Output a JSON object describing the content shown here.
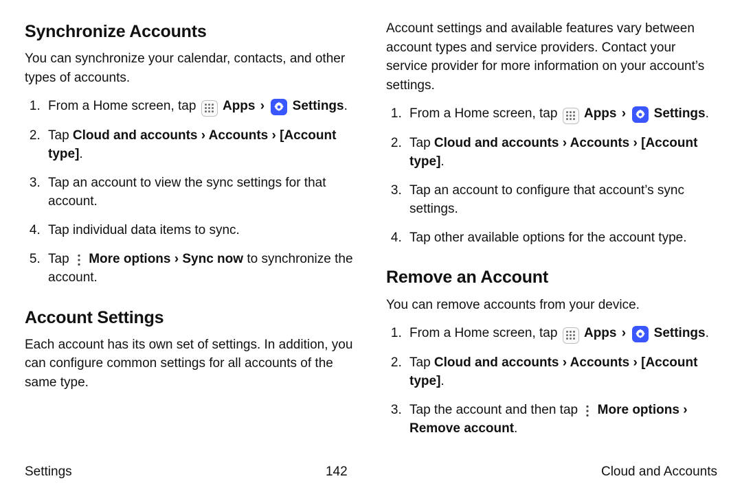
{
  "icons": {
    "apps": "Apps",
    "settings": "Settings",
    "more": "More options"
  },
  "left": {
    "sync": {
      "heading": "Synchronize Accounts",
      "intro": "You can synchronize your calendar, contacts, and other types of accounts.",
      "steps": {
        "s1_pre": "From a Home screen, tap ",
        "s1_apps": "Apps",
        "s1_settings": "Settings",
        "s1_post": ".",
        "s2_pre": "Tap ",
        "s2_bold": "Cloud and accounts › Accounts › [Account type]",
        "s2_post": ".",
        "s3": "Tap an account to view the sync settings for that account.",
        "s4": "Tap individual data items to sync.",
        "s5_pre": "Tap ",
        "s5_bold": "More options › Sync now",
        "s5_post": " to synchronize the account."
      }
    },
    "acct": {
      "heading": "Account Settings",
      "intro": "Each account has its own set of settings. In addition, you can configure common settings for all accounts of the same type."
    }
  },
  "right": {
    "acct_intro": "Account settings and available features vary between account types and service providers. Contact your service provider for more information on your account’s settings.",
    "acct_steps": {
      "s1_pre": "From a Home screen, tap ",
      "s1_apps": "Apps",
      "s1_settings": "Settings",
      "s1_post": ".",
      "s2_pre": "Tap ",
      "s2_bold": "Cloud and accounts › Accounts › [Account type]",
      "s2_post": ".",
      "s3": "Tap an account to configure that account’s sync settings.",
      "s4": "Tap other available options for the account type."
    },
    "remove": {
      "heading": "Remove an Account",
      "intro": "You can remove accounts from your device.",
      "steps": {
        "s1_pre": "From a Home screen, tap ",
        "s1_apps": "Apps",
        "s1_settings": "Settings",
        "s1_post": ".",
        "s2_pre": "Tap ",
        "s2_bold": "Cloud and accounts › Accounts › [Account type]",
        "s2_post": ".",
        "s3_pre": "Tap the account and then tap ",
        "s3_bold": "More options › Remove account",
        "s3_post": "."
      }
    }
  },
  "footer": {
    "left": "Settings",
    "center": "142",
    "right": "Cloud and Accounts"
  }
}
